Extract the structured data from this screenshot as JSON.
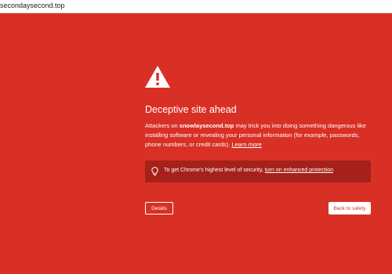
{
  "address_bar": {
    "url": "secondaysecond.top"
  },
  "interstitial": {
    "title": "Deceptive site ahead",
    "description": {
      "prefix": "Attackers on ",
      "site": "snowlaysecond.top",
      "suffix": " may trick you into doing something dangerous like installing software or revealing your personal information (for example, passwords, phone numbers, or credit cards). ",
      "learn_more": "Learn more"
    },
    "security_box": {
      "text": "To get Chrome's highest level of security, ",
      "link": "turn on enhanced protection"
    },
    "details_label": "Details",
    "back_label": "Back to safety"
  },
  "colors": {
    "background": "#d93025",
    "security_box": "#a52119",
    "text": "#ffffff"
  },
  "icons": {
    "warning": "warning-triangle-icon",
    "bulb": "lightbulb-icon"
  }
}
